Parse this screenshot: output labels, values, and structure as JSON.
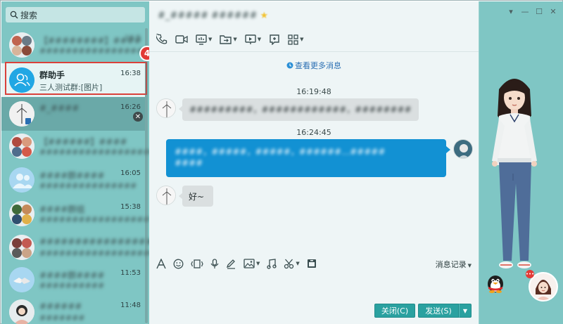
{
  "search": {
    "placeholder": "搜索"
  },
  "conversations": [
    {
      "name": "【########】####",
      "preview": "###################",
      "time": "16:5",
      "blurred": true
    },
    {
      "name": "群助手",
      "preview": "三人测试群:[图片]",
      "time": "16:38",
      "blurred": false
    },
    {
      "name": "#_####",
      "preview": "",
      "time": "16:26",
      "blurred": true
    },
    {
      "name": "【######】####",
      "preview": "######################",
      "time": "",
      "blurred": true
    },
    {
      "name": "####群####",
      "preview": "###############",
      "time": "16:05",
      "blurred": true
    },
    {
      "name": "####群组",
      "preview": "#################",
      "time": "15:38",
      "blurred": true
    },
    {
      "name": "#####################",
      "preview": "######################",
      "time": "",
      "blurred": true
    },
    {
      "name": "####群####",
      "preview": "##########",
      "time": "11:53",
      "blurred": true
    },
    {
      "name": "######",
      "preview": "#######",
      "time": "11:48",
      "blurred": true
    }
  ],
  "step_badge": "4",
  "chat": {
    "title": "#_#####  ######",
    "more_messages": "查看更多消息",
    "timestamps": [
      "16:19:48",
      "16:24:45"
    ],
    "messages": [
      {
        "side": "left",
        "text": "#########，############，###############！"
      },
      {
        "side": "right",
        "text": "####，#####，#####，######…#####",
        "text2": "####"
      },
      {
        "side": "left",
        "text": "好~"
      }
    ],
    "history_label": "消息记录",
    "close_label": "关闭(C)",
    "send_label": "发送(S)"
  },
  "colors": {
    "sidebar": "#7fc6c4",
    "accent_blue": "#1291d3",
    "button": "#2aa1a0",
    "highlight": "#d9413b"
  }
}
